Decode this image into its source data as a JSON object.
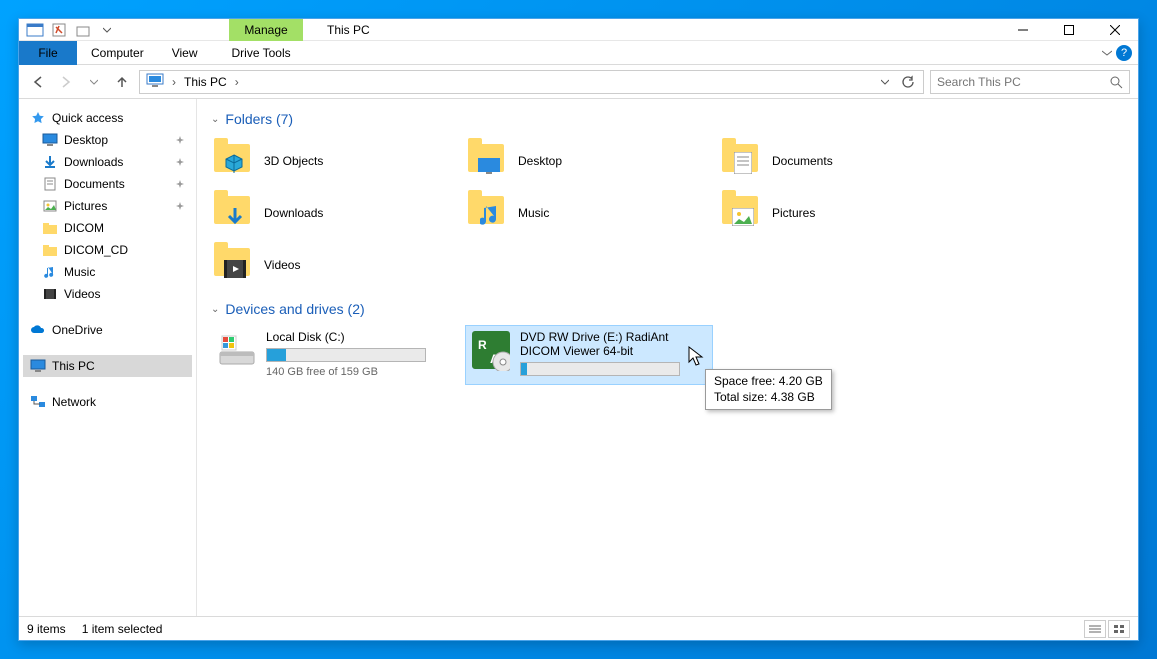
{
  "titlebar": {
    "title": "This PC",
    "ctx_label": "Manage"
  },
  "ribbon": {
    "file": "File",
    "tabs": [
      "Computer",
      "View"
    ],
    "ctx_tab": "Drive Tools"
  },
  "address": {
    "location": "This PC",
    "search_placeholder": "Search This PC"
  },
  "nav": {
    "quick_access": "Quick access",
    "qa_items": [
      {
        "label": "Desktop",
        "pinned": true,
        "icon": "desktop"
      },
      {
        "label": "Downloads",
        "pinned": true,
        "icon": "downloads"
      },
      {
        "label": "Documents",
        "pinned": true,
        "icon": "documents"
      },
      {
        "label": "Pictures",
        "pinned": true,
        "icon": "pictures"
      },
      {
        "label": "DICOM",
        "pinned": false,
        "icon": "folder"
      },
      {
        "label": "DICOM_CD",
        "pinned": false,
        "icon": "folder"
      },
      {
        "label": "Music",
        "pinned": false,
        "icon": "music"
      },
      {
        "label": "Videos",
        "pinned": false,
        "icon": "videos"
      }
    ],
    "onedrive": "OneDrive",
    "thispc": "This PC",
    "network": "Network"
  },
  "sections": {
    "folders_label": "Folders (7)",
    "drives_label": "Devices and drives (2)"
  },
  "folders": [
    {
      "label": "3D Objects",
      "icon": "3d"
    },
    {
      "label": "Desktop",
      "icon": "desktop"
    },
    {
      "label": "Documents",
      "icon": "documents"
    },
    {
      "label": "Downloads",
      "icon": "downloads"
    },
    {
      "label": "Music",
      "icon": "music"
    },
    {
      "label": "Pictures",
      "icon": "pictures"
    },
    {
      "label": "Videos",
      "icon": "videos"
    }
  ],
  "drives": [
    {
      "name": "Local Disk (C:)",
      "subtitle": "140 GB free of 159 GB",
      "fill_pct": 12,
      "icon": "disk",
      "selected": false,
      "bar_color": "#26a0da"
    },
    {
      "name": "DVD RW Drive (E:) RadiAnt DICOM Viewer 64-bit",
      "subtitle": "",
      "fill_pct": 4,
      "icon": "dvd",
      "selected": true,
      "bar_color": "#26a0da"
    }
  ],
  "tooltip": {
    "line1": "Space free: 4.20 GB",
    "line2": "Total size: 4.38 GB"
  },
  "status": {
    "items": "9 items",
    "selected": "1 item selected"
  }
}
